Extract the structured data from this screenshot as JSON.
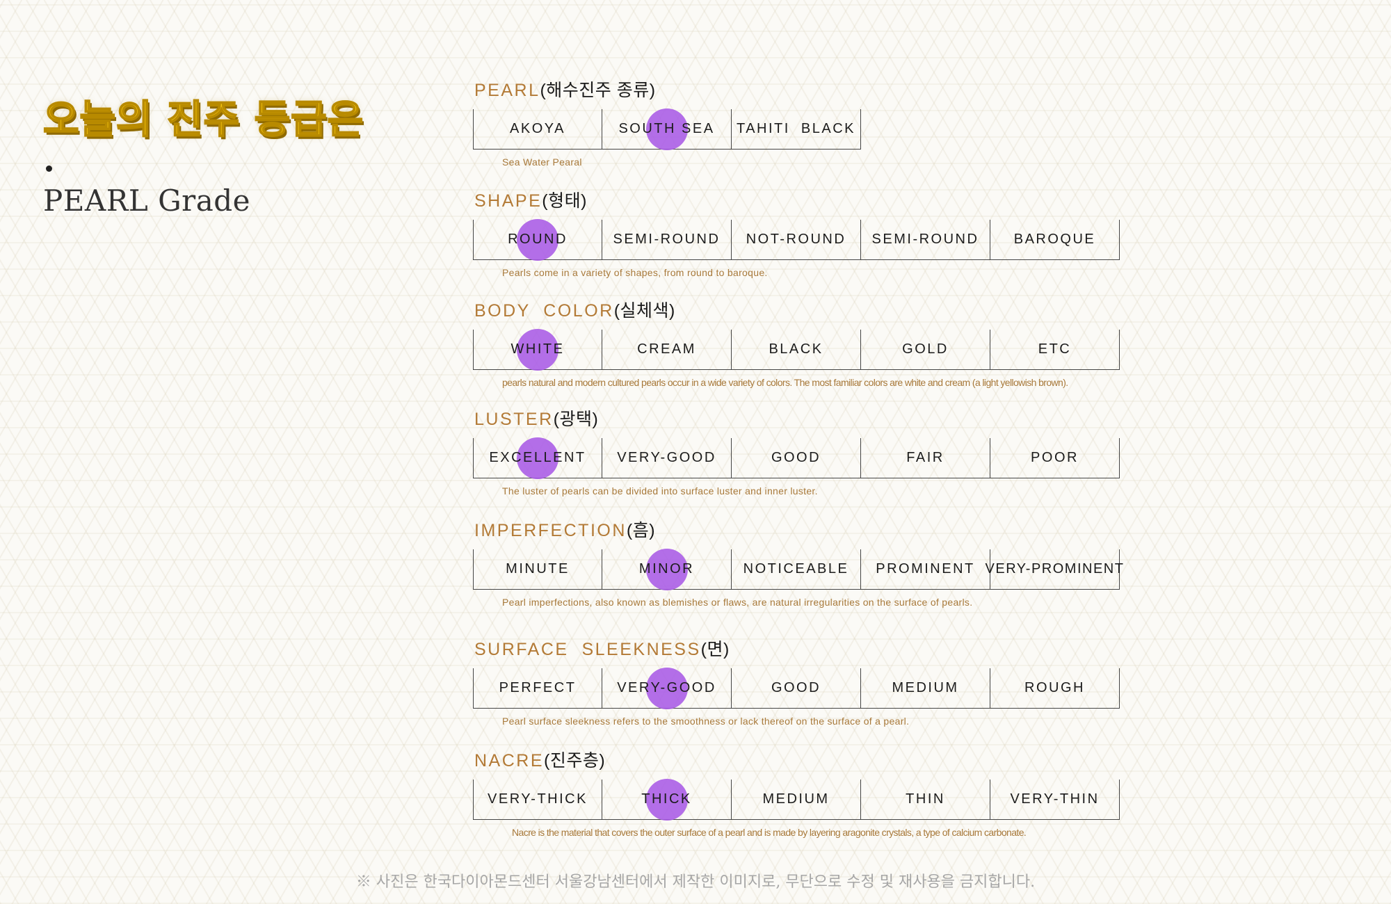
{
  "left": {
    "title": "오늘의 진주 등급은",
    "subtitle": "PEARL Grade"
  },
  "sections": [
    {
      "title_en": "PEARL",
      "title_ko": "(해수진주 종류)",
      "options": [
        "AKOYA",
        "SOUTH SEA",
        "TAHITI  BLACK"
      ],
      "selected": 1,
      "description": "Sea Water Pearal"
    },
    {
      "title_en": "SHAPE",
      "title_ko": "(형태)",
      "options": [
        "ROUND",
        "SEMI-ROUND",
        "NOT-ROUND",
        "SEMI-ROUND",
        "BAROQUE"
      ],
      "selected": 0,
      "description": "Pearls come in a variety of shapes, from round to baroque."
    },
    {
      "title_en": "BODY  COLOR",
      "title_ko": "(실체색)",
      "options": [
        "WHITE",
        "CREAM",
        "BLACK",
        "GOLD",
        "ETC"
      ],
      "selected": 0,
      "description": "pearls natural and modern cultured pearls occur in a wide variety of colors. The most familiar colors are white and cream (a light yellowish brown)."
    },
    {
      "title_en": "LUSTER",
      "title_ko": "(광택)",
      "options": [
        "EXCELLENT",
        "VERY-GOOD",
        "GOOD",
        "FAIR",
        "POOR"
      ],
      "selected": 0,
      "description": "The luster of pearls can be divided into surface luster and inner luster."
    },
    {
      "title_en": "IMPERFECTION",
      "title_ko": "(흠)",
      "options": [
        "MINUTE",
        "MINOR",
        "NOTICEABLE",
        "PROMINENT",
        "VERY-PROMINENT"
      ],
      "selected": 1,
      "description": "Pearl imperfections, also known as blemishes or flaws, are natural irregularities on the surface of pearls."
    },
    {
      "title_en": "SURFACE  SLEEKNESS",
      "title_ko": "(면)",
      "options": [
        "PERFECT",
        "VERY-GOOD",
        "GOOD",
        "MEDIUM",
        "ROUGH"
      ],
      "selected": 1,
      "description": "Pearl surface sleekness refers to the smoothness or lack thereof on the surface of a pearl."
    },
    {
      "title_en": "NACRE",
      "title_ko": "(진주층)",
      "options": [
        "VERY-THICK",
        "THICK",
        "MEDIUM",
        "THIN",
        "VERY-THIN"
      ],
      "selected": 1,
      "description": "Nacre is the material that covers the outer surface of a pearl and is made by layering aragonite crystals, a type of calcium carbonate."
    }
  ],
  "footer": "※ 사진은 한국다이아몬드센터 서울강남센터에서 제작한 이미지로, 무단으로 수정 및 재사용을 금지합니다.",
  "colors": {
    "title_yellow": "#f4c40f",
    "section_title": "#b37a36",
    "description": "#a8793a",
    "selection_circle": "#a85ae6"
  }
}
